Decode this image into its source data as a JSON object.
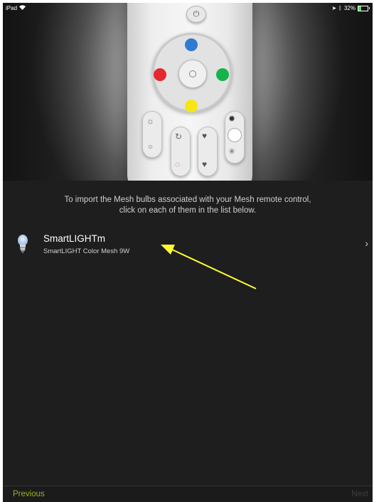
{
  "status_bar": {
    "device": "iPad",
    "battery": "32%",
    "battery_level": 0.32,
    "wifi_icon": "wifi-icon",
    "location_icon": "location-arrow-icon",
    "bluetooth_icon": "bluetooth-icon"
  },
  "hero": {
    "image": "mesh-remote-control-illustration",
    "colors": {
      "blue": "#2f7bd1",
      "red": "#e6262d",
      "green": "#16b34a",
      "yellow": "#f6e617"
    }
  },
  "instruction": {
    "line1": "To import the Mesh bulbs associated with your Mesh remote control,",
    "line2": "click on each of them in the list below."
  },
  "bulbs": [
    {
      "name": "SmartLIGHTm",
      "model": "SmartLIGHT Color Mesh 9W",
      "icon": "light-bulb-icon"
    }
  ],
  "annotation": {
    "type": "yellow-arrow",
    "color": "#ffff33"
  },
  "footer": {
    "previous_label": "Previous",
    "next_label": "Next",
    "accent": "#9ab31f"
  }
}
